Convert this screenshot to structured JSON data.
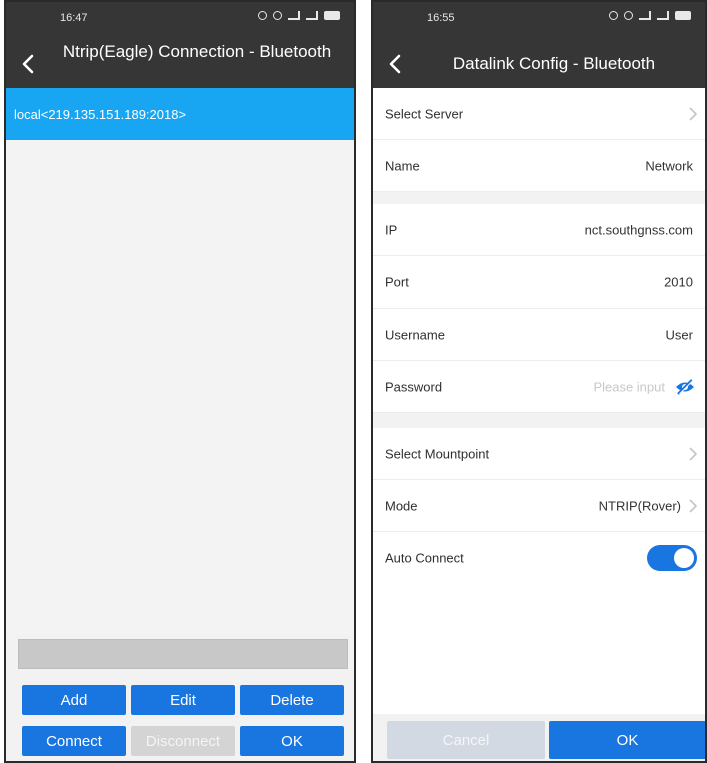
{
  "left_screen": {
    "status": {
      "time": "16:47"
    },
    "title": "Ntrip(Eagle) Connection - Bluetooth",
    "connection_item": "local<219.135.151.189:2018>",
    "buttons": {
      "add": "Add",
      "edit": "Edit",
      "delete": "Delete",
      "connect": "Connect",
      "disconnect": "Disconnect",
      "ok": "OK"
    }
  },
  "right_screen": {
    "status": {
      "time": "16:55"
    },
    "title": "Datalink Config - Bluetooth",
    "rows": {
      "select_server": {
        "label": "Select Server"
      },
      "name": {
        "label": "Name",
        "value": "Network"
      },
      "ip": {
        "label": "IP",
        "value": "nct.southgnss.com"
      },
      "port": {
        "label": "Port",
        "value": "2010"
      },
      "username": {
        "label": "Username",
        "value": "User"
      },
      "password": {
        "label": "Password",
        "placeholder": "Please input"
      },
      "select_mountpoint": {
        "label": "Select Mountpoint"
      },
      "mode": {
        "label": "Mode",
        "value": "NTRIP(Rover)"
      },
      "auto_connect": {
        "label": "Auto Connect",
        "on": true
      }
    },
    "buttons": {
      "cancel": "Cancel",
      "ok": "OK"
    }
  },
  "colors": {
    "header": "#363636",
    "selected_row": "#18a6f2",
    "primary_button": "#1976e0",
    "disabled_button": "#d4d4d4"
  },
  "icons": [
    "back-arrow-icon",
    "chevron-right-icon",
    "eye-off-icon"
  ]
}
